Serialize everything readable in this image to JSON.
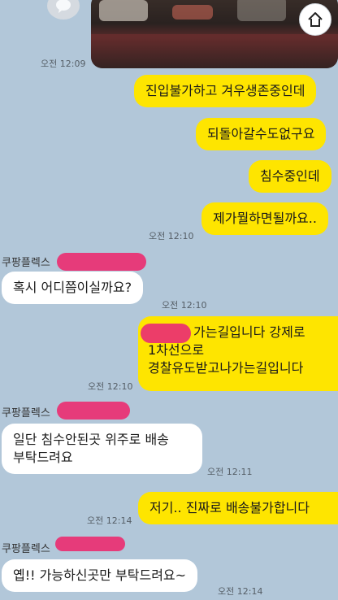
{
  "header": {
    "first_time": "오전 12:09"
  },
  "messages": [
    {
      "side": "mine",
      "text": "진입불가하고 겨우생존중인데"
    },
    {
      "side": "mine",
      "text": "되돌아갈수도없구요"
    },
    {
      "side": "mine",
      "text": "침수중인데"
    },
    {
      "side": "mine",
      "text": "제가뭘하면될까요..",
      "time": "오전 12:10"
    },
    {
      "side": "theirs",
      "sender": "쿠팡플렉스",
      "text": "혹시 어디쯤이실까요?",
      "time": "오전 12:10"
    },
    {
      "side": "mine",
      "lines": [
        "가는길입니다 강제로",
        "1차선으로",
        "경찰유도받고나가는길입니다"
      ],
      "time": "오전 12:10"
    },
    {
      "side": "theirs",
      "sender": "쿠팡플렉스",
      "lines": [
        "일단 침수안된곳 위주로 배송",
        "부탁드려요"
      ],
      "time": "오전 12:11"
    },
    {
      "side": "mine",
      "text": "저기.. 진짜로 배송불가합니다",
      "time": "오전 12:14"
    },
    {
      "side": "theirs",
      "sender": "쿠팡플렉스",
      "text": "옙!! 가능하신곳만 부탁드려요~",
      "time": "오전 12:14"
    }
  ]
}
